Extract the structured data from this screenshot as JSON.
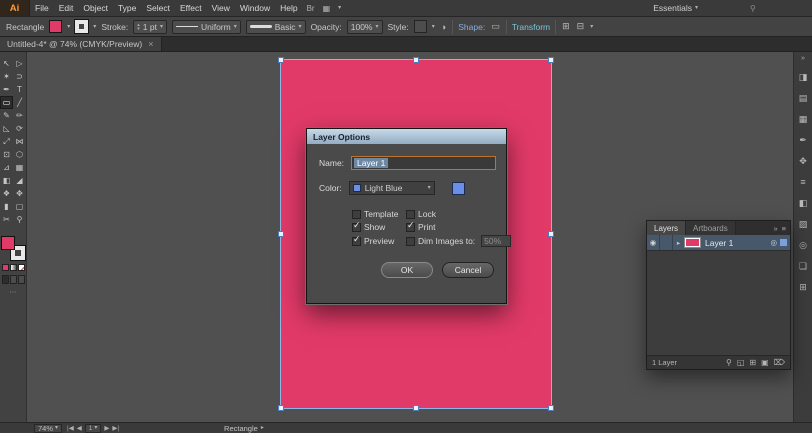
{
  "colors": {
    "artwork_pink": "#e23a68",
    "selection_blue": "#8fb6e8",
    "layer_color_light_blue": "#6a8fe8",
    "dialog_titlebar_blue": "#b5cbdf",
    "shape_link_blue": "#86aee0",
    "transform_link_teal": "#7cc5d8"
  },
  "icons": {
    "caret_down": "▾",
    "caret_right": "▸",
    "spinner_up": "▴",
    "spinner_down": "▾",
    "check": "✓",
    "collapse_double": "»",
    "panel_menu": "≡",
    "recolor": "◑",
    "shape_widget": "▭",
    "align_1": "⊞",
    "align_2": "⊟",
    "bridge": "Br",
    "arrange_docs": "▦",
    "search": "⚲"
  },
  "menubar": {
    "logo": "Ai",
    "items": [
      "File",
      "Edit",
      "Object",
      "Type",
      "Select",
      "Effect",
      "View",
      "Window",
      "Help"
    ],
    "workspace": "Essentials"
  },
  "controlbar": {
    "tool_label": "Rectangle",
    "stroke_label": "Stroke:",
    "stroke_value": "1 pt",
    "profile_value": "Uniform",
    "brush_value": "Basic",
    "opacity_label": "Opacity:",
    "opacity_value": "100%",
    "style_label": "Style:",
    "shape_label": "Shape:",
    "transform_label": "Transform"
  },
  "tabbar": {
    "doc_title": "Untitled-4* @ 74% (CMYK/Preview)",
    "close": "×"
  },
  "tools": [
    {
      "name": "selection",
      "glyph": "↖"
    },
    {
      "name": "direct-selection",
      "glyph": "▷"
    },
    {
      "name": "magic-wand",
      "glyph": "✶"
    },
    {
      "name": "lasso",
      "glyph": "⊃"
    },
    {
      "name": "pen",
      "glyph": "✒"
    },
    {
      "name": "type",
      "glyph": "T"
    },
    {
      "name": "rectangle",
      "glyph": "▭"
    },
    {
      "name": "line",
      "glyph": "╱"
    },
    {
      "name": "paintbrush",
      "glyph": "✎"
    },
    {
      "name": "pencil",
      "glyph": "✏"
    },
    {
      "name": "eraser",
      "glyph": "◺"
    },
    {
      "name": "rotate",
      "glyph": "⟳"
    },
    {
      "name": "scale",
      "glyph": "⤢"
    },
    {
      "name": "width",
      "glyph": "⋈"
    },
    {
      "name": "free-transform",
      "glyph": "⊡"
    },
    {
      "name": "shape-builder",
      "glyph": "⬡"
    },
    {
      "name": "perspective-grid",
      "glyph": "⊿"
    },
    {
      "name": "mesh",
      "glyph": "▦"
    },
    {
      "name": "gradient",
      "glyph": "◧"
    },
    {
      "name": "eyedropper",
      "glyph": "◢"
    },
    {
      "name": "blend",
      "glyph": "❖"
    },
    {
      "name": "symbol-sprayer",
      "glyph": "✥"
    },
    {
      "name": "column-graph",
      "glyph": "▮"
    },
    {
      "name": "artboard",
      "glyph": "▢"
    },
    {
      "name": "slice",
      "glyph": "✂"
    },
    {
      "name": "hand",
      "glyph": "⚲"
    }
  ],
  "dialog": {
    "title": "Layer Options",
    "name_label": "Name:",
    "name_value": "Layer 1",
    "color_label": "Color:",
    "color_value": "Light Blue",
    "template_label": "Template",
    "lock_label": "Lock",
    "show_label": "Show",
    "print_label": "Print",
    "preview_label": "Preview",
    "dim_label": "Dim Images to:",
    "dim_value": "50%",
    "ok_label": "OK",
    "cancel_label": "Cancel"
  },
  "layers_panel": {
    "tabs": [
      "Layers",
      "Artboards"
    ],
    "row": {
      "name": "Layer 1",
      "eye": "◉",
      "disclosure": "▸",
      "target": "◎"
    },
    "footer": {
      "count": "1 Layer",
      "locate_icon": "⚲",
      "clip_icon": "◱",
      "sublayer_icon": "⊞",
      "new_icon": "▣",
      "delete_icon": "⌦"
    }
  },
  "dock_icons": [
    {
      "name": "color",
      "glyph": "◨"
    },
    {
      "name": "color-guide",
      "glyph": "▤"
    },
    {
      "name": "swatches",
      "glyph": "▦"
    },
    {
      "name": "brushes",
      "glyph": "✒"
    },
    {
      "name": "symbols",
      "glyph": "✥"
    },
    {
      "name": "stroke",
      "glyph": "≡"
    },
    {
      "name": "gradient",
      "glyph": "◧"
    },
    {
      "name": "transparency",
      "glyph": "▨"
    },
    {
      "name": "appearance",
      "glyph": "◎"
    },
    {
      "name": "graphic-styles",
      "glyph": "❏"
    },
    {
      "name": "navigator",
      "glyph": "⊞"
    }
  ],
  "statusbar": {
    "zoom": "74%",
    "nav_first": "|◀",
    "nav_prev": "◀",
    "artboard": "1",
    "nav_next": "▶",
    "nav_last": "▶|",
    "status_label": "Rectangle"
  }
}
